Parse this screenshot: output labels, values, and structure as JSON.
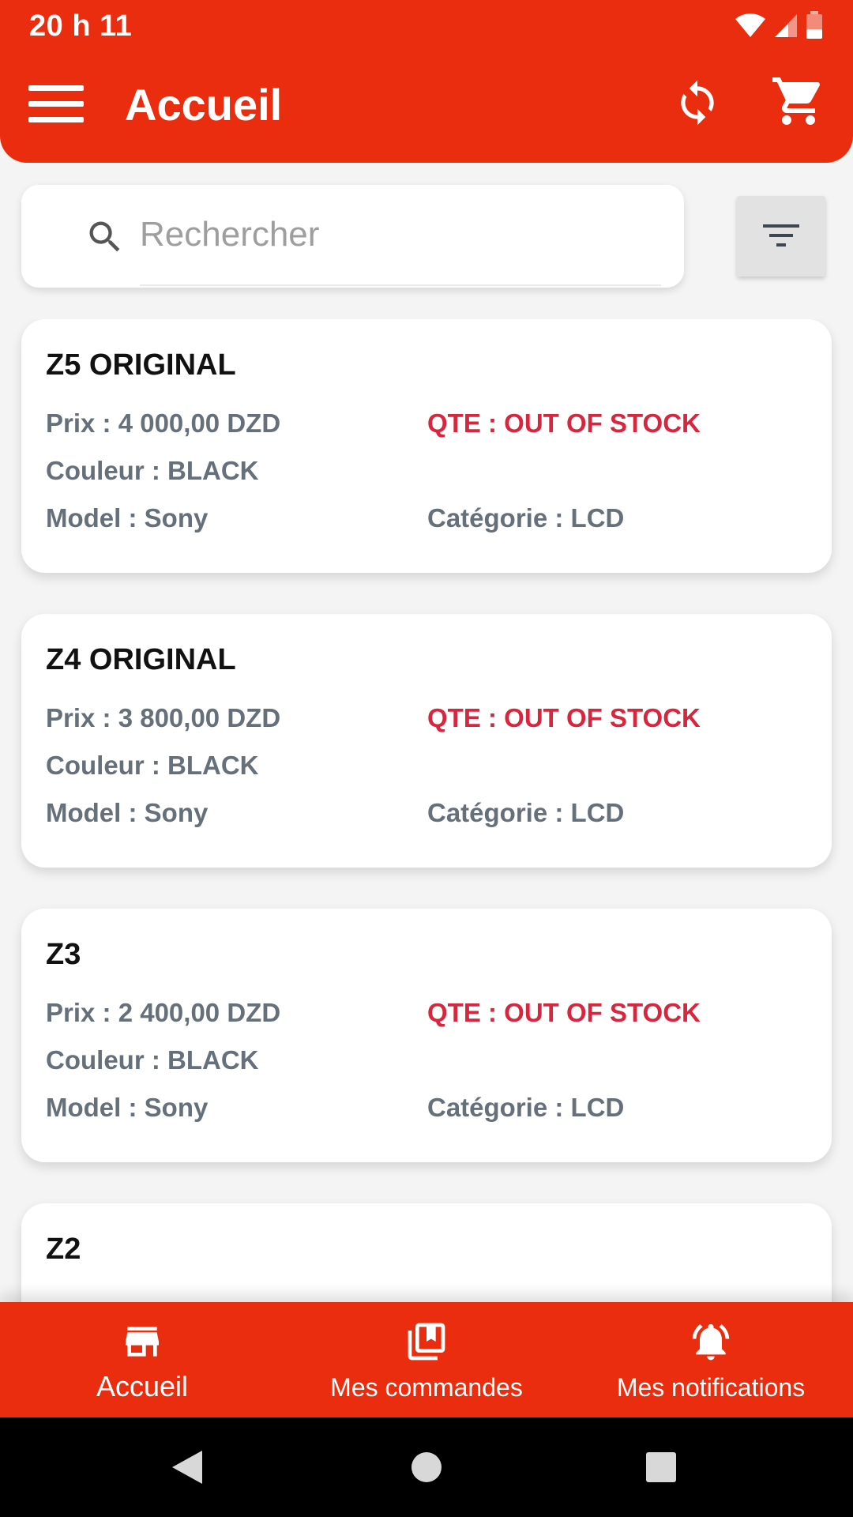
{
  "status_bar": {
    "time": "20 h 11",
    "icons": [
      "wifi-icon",
      "signal-icon",
      "battery-low-icon"
    ]
  },
  "app_bar": {
    "title": "Accueil",
    "menu_icon": "menu-icon",
    "sync_icon": "sync-icon",
    "cart_icon": "shopping-cart-icon"
  },
  "search": {
    "placeholder": "Rechercher",
    "value": "",
    "icon": "search-icon",
    "filter_icon": "filter-icon"
  },
  "products": [
    {
      "name": "Z5 ORIGINAL",
      "prix": "Prix : 4 000,00 DZD",
      "qte": "QTE : OUT OF STOCK",
      "couleur": "Couleur : BLACK",
      "model": "Model : Sony",
      "categorie": "Catégorie : LCD"
    },
    {
      "name": "Z4 ORIGINAL",
      "prix": "Prix : 3 800,00 DZD",
      "qte": "QTE : OUT OF STOCK",
      "couleur": "Couleur : BLACK",
      "model": "Model : Sony",
      "categorie": "Catégorie : LCD"
    },
    {
      "name": "Z3",
      "prix": "Prix : 2 400,00 DZD",
      "qte": "QTE : OUT OF STOCK",
      "couleur": "Couleur : BLACK",
      "model": "Model : Sony",
      "categorie": "Catégorie : LCD"
    },
    {
      "name": "Z2"
    }
  ],
  "bottom_nav": {
    "items": [
      {
        "label": "Accueil",
        "icon": "store-icon",
        "active": true
      },
      {
        "label": "Mes commandes",
        "icon": "orders-icon",
        "active": false
      },
      {
        "label": "Mes notifications",
        "icon": "notification-bell-icon",
        "active": false
      }
    ]
  },
  "system_nav": [
    "back-icon",
    "home-icon",
    "recents-icon"
  ],
  "colors": {
    "primary": "#e92d0e",
    "out_of_stock": "#d7263d",
    "label_gray": "#66707a",
    "background": "#f4f4f4"
  }
}
